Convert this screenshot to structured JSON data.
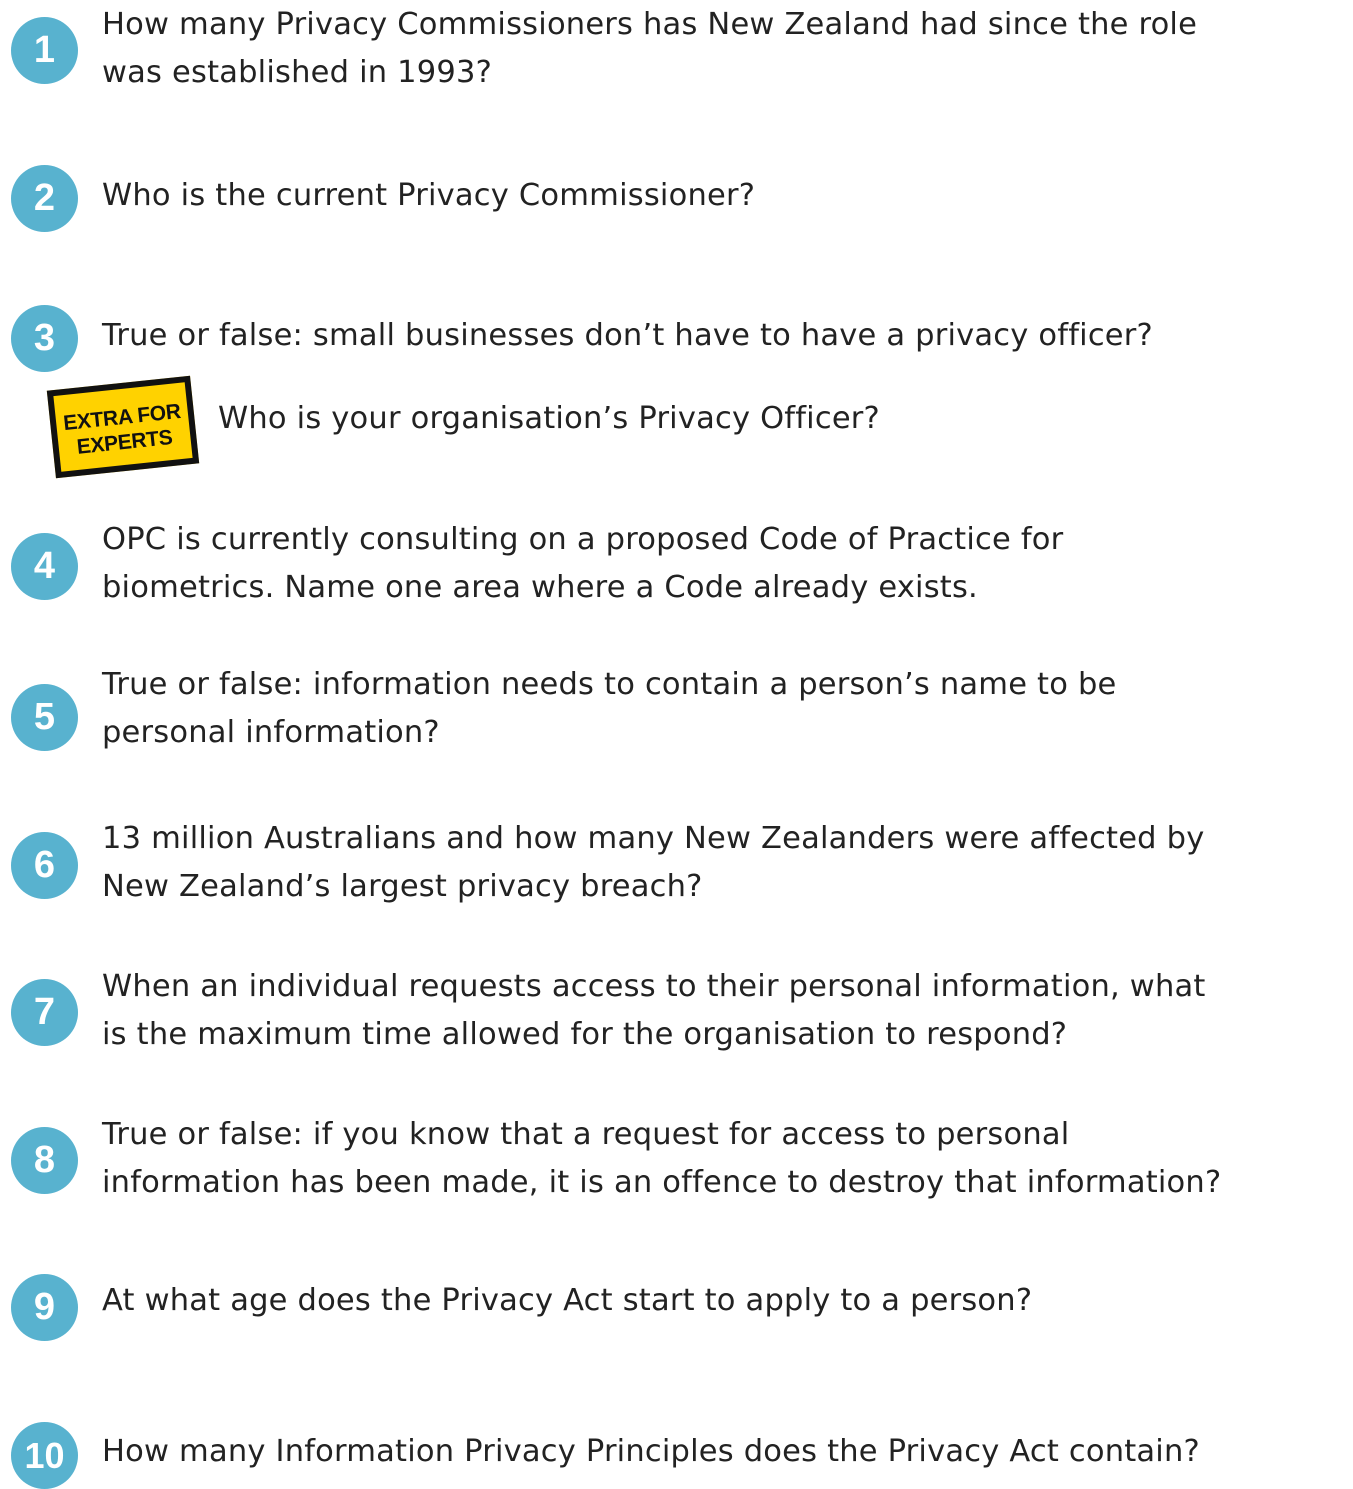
{
  "colors": {
    "circle": "#58b2cf",
    "badge_fill": "#ffd200",
    "badge_border": "#111111",
    "text": "#222222"
  },
  "questions": [
    {
      "number": "1",
      "lines": [
        "How many Privacy Commissioners has New Zealand had since the role",
        "was established in 1993?"
      ]
    },
    {
      "number": "2",
      "lines": [
        "Who is the current Privacy Commissioner?"
      ]
    },
    {
      "number": "3",
      "lines": [
        "True or false: small businesses don’t have to have a privacy officer?"
      ]
    },
    {
      "number": "4",
      "lines": [
        "OPC is currently consulting on a proposed Code of Practice for",
        "biometrics. Name one area where a Code already exists."
      ]
    },
    {
      "number": "5",
      "lines": [
        "True or false: information needs to contain a person’s name to be",
        "personal information?"
      ]
    },
    {
      "number": "6",
      "lines": [
        "13 million Australians and how many New Zealanders were affected by",
        "New Zealand’s largest privacy breach?"
      ]
    },
    {
      "number": "7",
      "lines": [
        "When an individual requests access to their personal information, what",
        "is the maximum time allowed for the organisation to respond?"
      ]
    },
    {
      "number": "8",
      "lines": [
        "True or false: if you know that a request for access to personal",
        "information has been made, it is an offence to destroy that information?"
      ]
    },
    {
      "number": "9",
      "lines": [
        "At what age does the Privacy Act start to apply to a person?"
      ]
    },
    {
      "number": "10",
      "lines": [
        "How many Information Privacy Principles does the Privacy Act contain?"
      ]
    }
  ],
  "extra": {
    "badge_line1": "EXTRA FOR",
    "badge_line2": "EXPERTS",
    "question": "Who is your organisation’s Privacy Officer?"
  }
}
